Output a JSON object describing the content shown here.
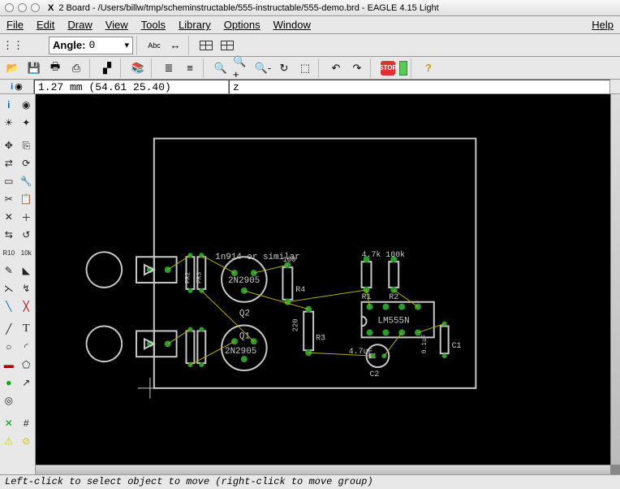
{
  "window": {
    "x_label": "X",
    "title": "2 Board - /Users/billw/tmp/scheminstructable/555-instructable/555-demo.brd - EAGLE 4.15 Light"
  },
  "menu": {
    "file": "File",
    "edit": "Edit",
    "draw": "Draw",
    "view": "View",
    "tools": "Tools",
    "library": "Library",
    "options": "Options",
    "window": "Window",
    "help": "Help"
  },
  "toolbar": {
    "angle_label": "Angle:",
    "angle_value": "0",
    "abc": "Abc",
    "dim": "↔",
    "stop": "STOP"
  },
  "coords": {
    "readout": "1.27 mm (54.61 25.40)",
    "command": "z"
  },
  "board": {
    "d1_label": "1n914 or similar",
    "q_part": "2N2905",
    "q1": "Q1",
    "q2": "Q2",
    "r1": "R1",
    "r2": "R2",
    "r3": "R3",
    "r4": "R4",
    "r1_val": "4.7k",
    "r2_val": "100k",
    "r3_val": "220",
    "r4_val": "100",
    "c1": "C1",
    "c2": "C2",
    "c1_val": "0.1uF",
    "c2_val": "4.7uF",
    "ic": "LM555N",
    "led_r_a": "PR2",
    "led_r_b": "PR3"
  },
  "status": {
    "text": "Left-click to select object to move (right-click to move group)"
  }
}
